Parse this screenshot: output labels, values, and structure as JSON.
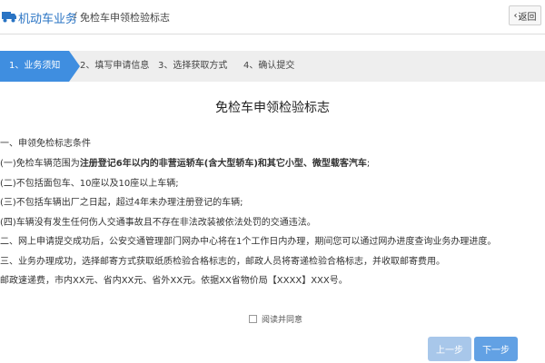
{
  "header": {
    "module": "机动车业务",
    "separator": "/",
    "page": "免检车申领检验标志",
    "back_label": "返回"
  },
  "steps": [
    {
      "label": "1、业务须知",
      "active": true
    },
    {
      "label": "2、填写申请信息",
      "active": false
    },
    {
      "label": "3、选择获取方式",
      "active": false
    },
    {
      "label": "4、确认提交",
      "active": false
    }
  ],
  "content": {
    "title": "免检车申领检验标志",
    "section1": "一、申领免检标志条件",
    "item1_prefix": "(一)免检车辆范围为",
    "item1_bold": "注册登记6年以内的非营运轿车(含大型轿车)和其它小型、微型载客汽车",
    "item1_suffix": ";",
    "item2": "(二)不包括面包车、10座以及10座以上车辆;",
    "item3": "(三)不包括车辆出厂之日起，超过4年未办理注册登记的车辆;",
    "item4": "(四)车辆没有发生任何伤人交通事故且不存在非法改装被依法处罚的交通违法。",
    "section2": "二、网上申请提交成功后，公安交通管理部门网办中心将在1个工作日内办理，期间您可以通过网办进度查询业务办理进度。",
    "section3": "三、业务办理成功，选择邮寄方式获取纸质检验合格标志的，邮政人员将寄递检验合格标志，并收取邮寄费用。",
    "section4": "邮政速递费，市内XX元、省内XX元、省外XX元。依据XX省物价局【XXXX】XXX号。"
  },
  "agree_label": "阅读并同意",
  "buttons": {
    "prev": "上一步",
    "next": "下一步"
  },
  "colors": {
    "accent": "#3f8ee0",
    "link": "#2a74c4",
    "prev": "#a8c7ea",
    "next": "#62a1e4"
  }
}
